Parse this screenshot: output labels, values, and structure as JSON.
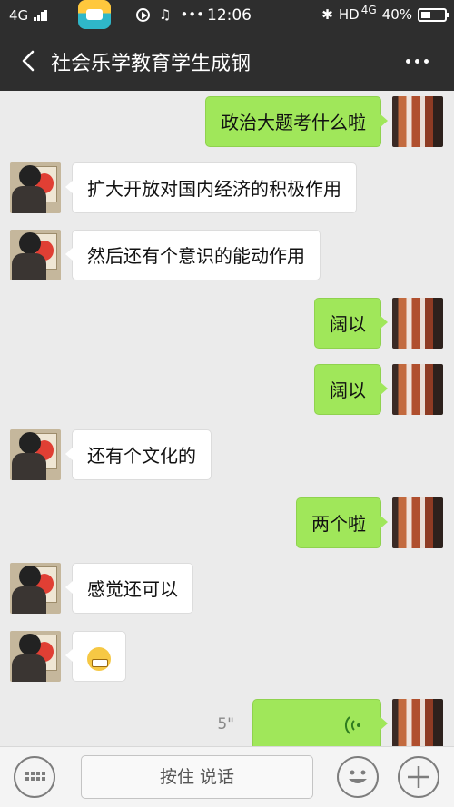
{
  "status_bar": {
    "network": "4G",
    "time": "12:06",
    "bluetooth": "bluetooth-icon",
    "hd": "HD",
    "network_right": "4G",
    "battery": "40%"
  },
  "header": {
    "title": "社会乐学教育学生成钢"
  },
  "messages": [
    {
      "side": "right",
      "text": "政治大题考什么啦"
    },
    {
      "side": "left",
      "text": "扩大开放对国内经济的积极作用"
    },
    {
      "side": "left",
      "text": "然后还有个意识的能动作用"
    },
    {
      "side": "right",
      "text": "阔以"
    },
    {
      "side": "right",
      "text": "阔以"
    },
    {
      "side": "left",
      "text": "还有个文化的"
    },
    {
      "side": "right",
      "text": "两个啦"
    },
    {
      "side": "left",
      "text": "感觉还可以"
    },
    {
      "side": "left",
      "emoji": "grimacing-face-icon"
    },
    {
      "side": "right",
      "voice": true,
      "duration": "5\""
    }
  ],
  "input_bar": {
    "hold_to_talk": "按住 说话"
  },
  "colors": {
    "header_bg": "#2e2e2e",
    "chat_bg": "#ebebeb",
    "sent_bubble": "#a0e75a",
    "received_bubble": "#ffffff"
  }
}
